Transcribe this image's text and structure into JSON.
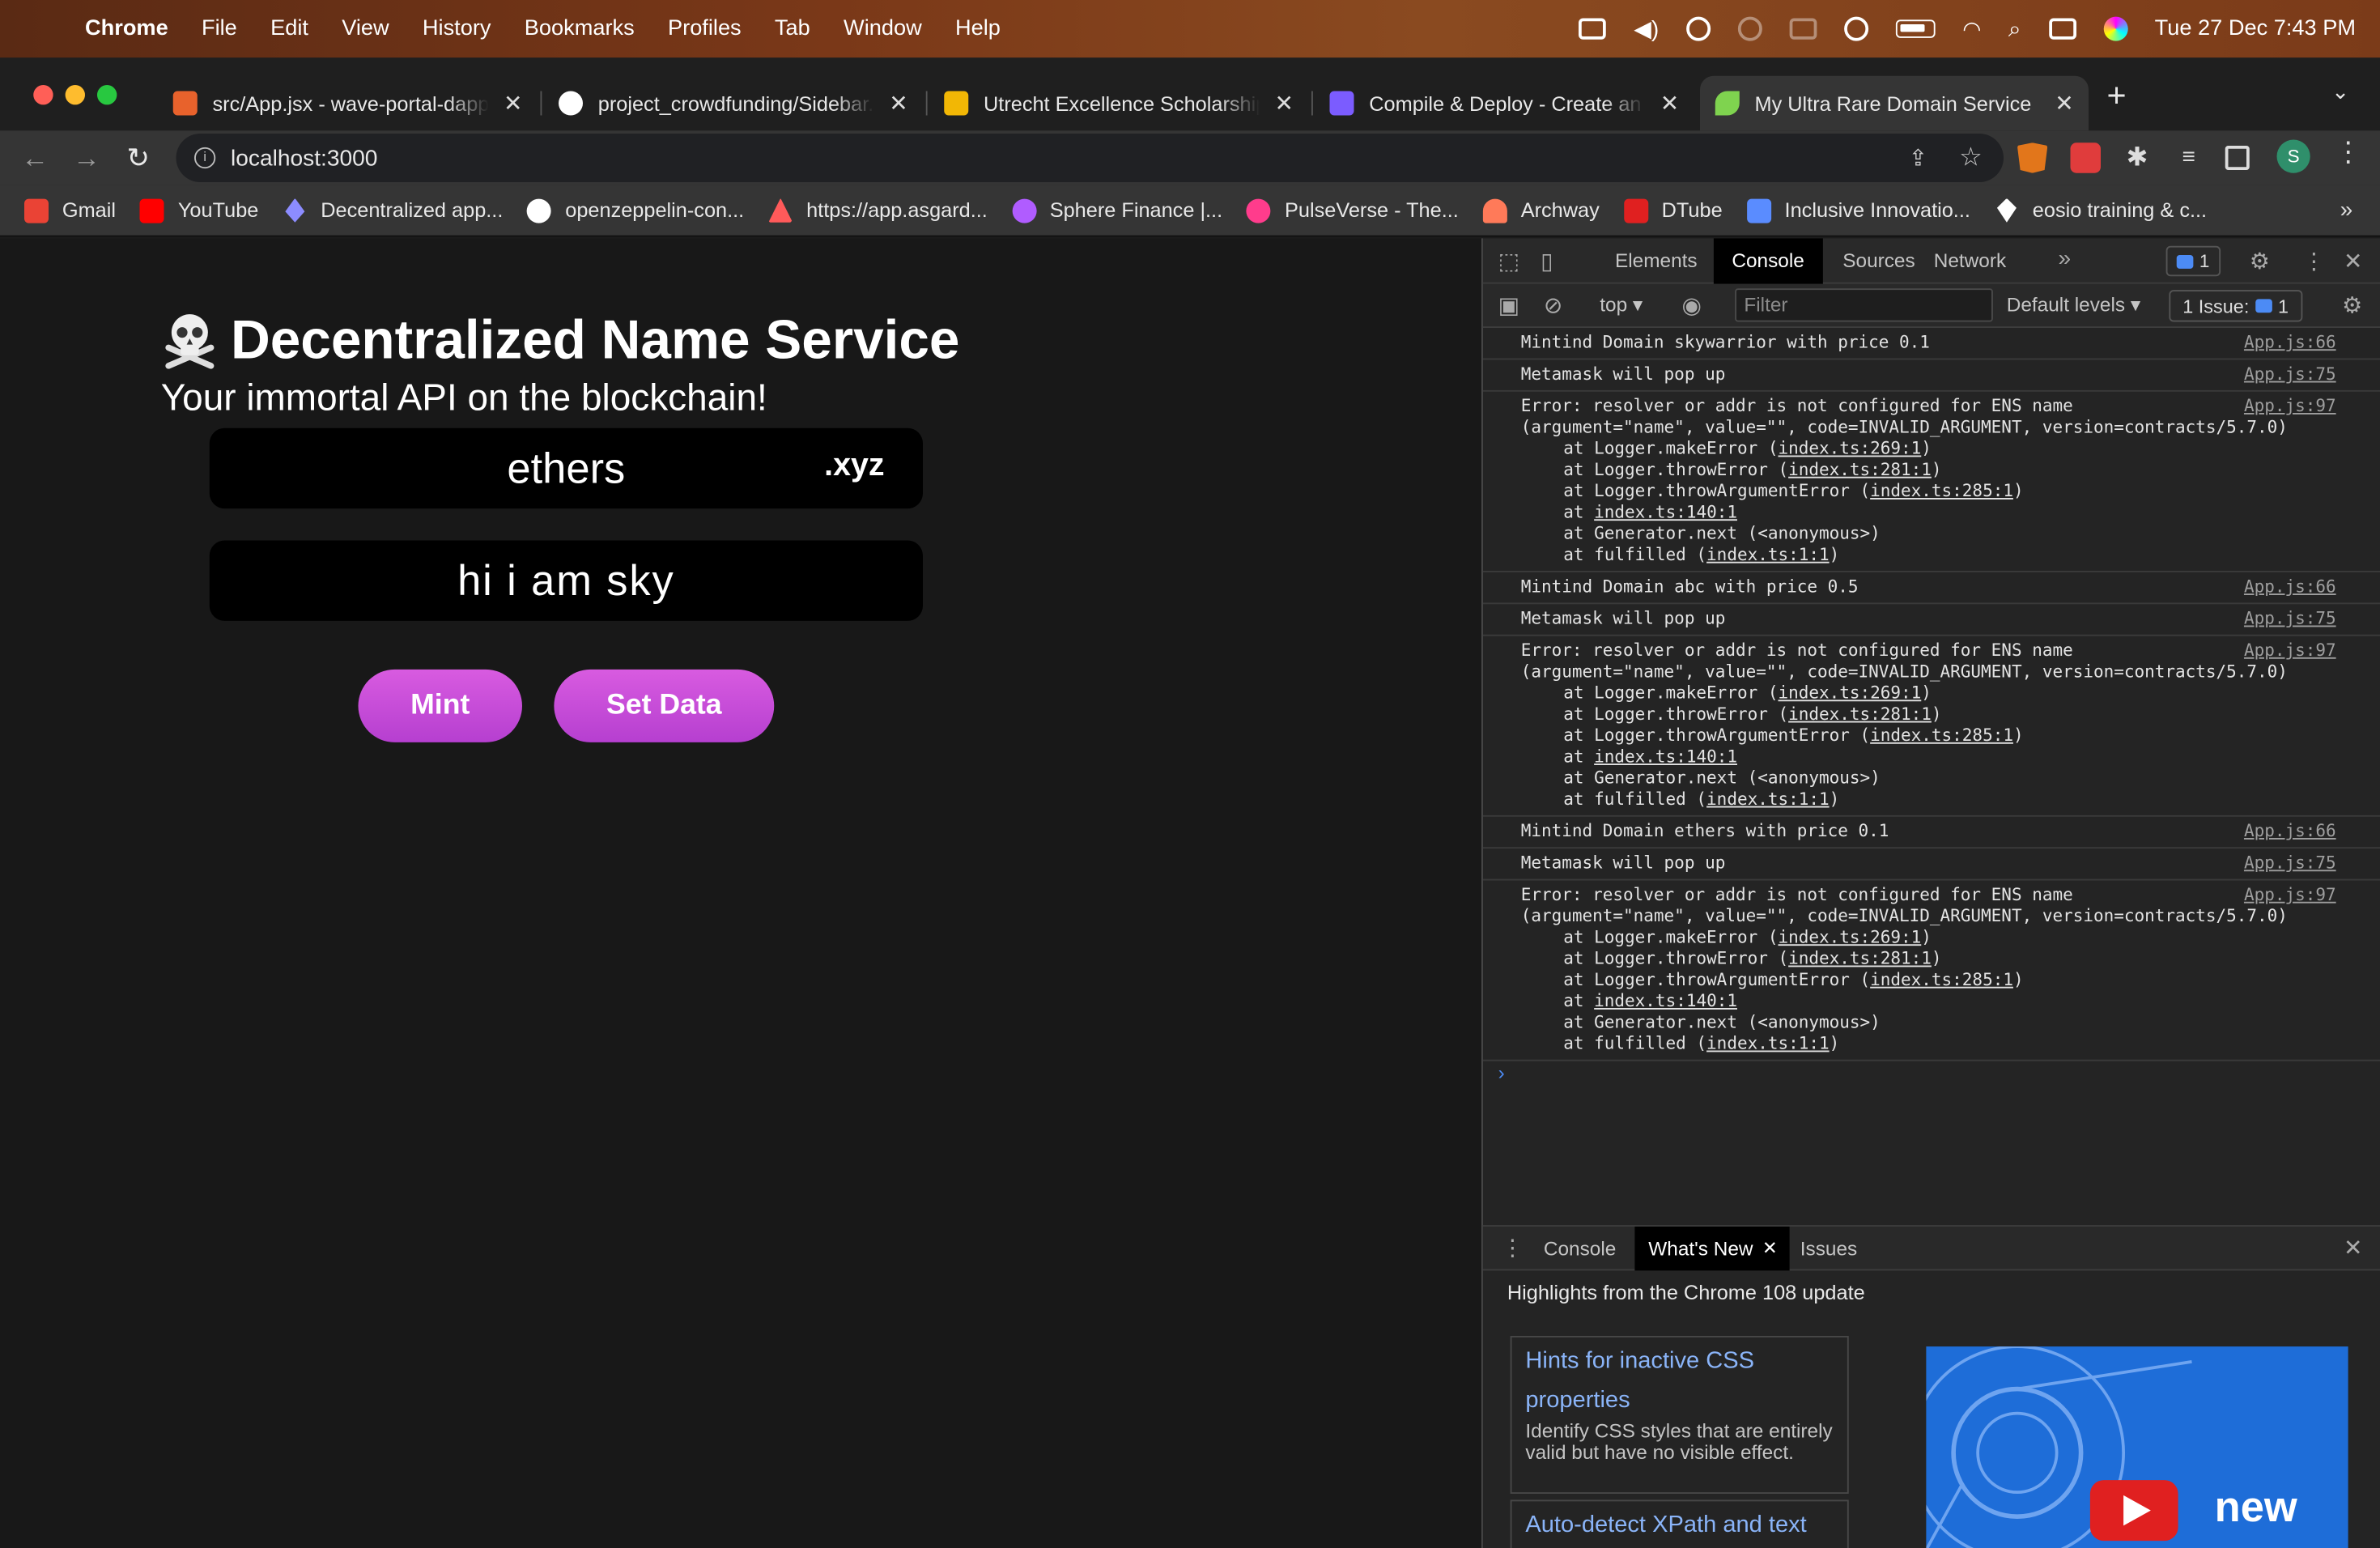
{
  "menubar": {
    "app": "Chrome",
    "items": [
      "File",
      "Edit",
      "View",
      "History",
      "Bookmarks",
      "Profiles",
      "Tab",
      "Window",
      "Help"
    ],
    "clock": "Tue 27 Dec  7:43 PM"
  },
  "tabs": [
    {
      "title": "src/App.jsx - wave-portal-dapp",
      "favicon_color": "#e8622c"
    },
    {
      "title": "project_crowdfunding/Sidebar.",
      "favicon_color": "#ffffff"
    },
    {
      "title": "Utrecht Excellence Scholarship",
      "favicon_color": "#f2b705"
    },
    {
      "title": "Compile & Deploy - Create an N",
      "favicon_color": "#7b5cff"
    },
    {
      "title": "My Ultra Rare Domain Service",
      "favicon_color": "#7fd34f"
    }
  ],
  "address": {
    "url": "localhost:3000"
  },
  "bookmarks": [
    {
      "label": "Gmail",
      "color": "#ea4335"
    },
    {
      "label": "YouTube",
      "color": "#ff0000"
    },
    {
      "label": "Decentralized app...",
      "color": "#8c8cff"
    },
    {
      "label": "openzeppelin-con...",
      "color": "#ffffff"
    },
    {
      "label": "https://app.asgard...",
      "color": "#ff5a5a"
    },
    {
      "label": "Sphere Finance |...",
      "color": "#b05cff"
    },
    {
      "label": "PulseVerse - The...",
      "color": "#ff3c8c"
    },
    {
      "label": "Archway",
      "color": "#ff7a59"
    },
    {
      "label": "DTube",
      "color": "#e02020"
    },
    {
      "label": "Inclusive Innovatio...",
      "color": "#5a8cff"
    },
    {
      "label": "eosio training & c...",
      "color": "#ffffff"
    }
  ],
  "page": {
    "title": "Decentralized Name Service",
    "subtitle": "Your immortal API on the blockchain!",
    "domain_value": "ethers",
    "tld": ".xyz",
    "record_value": "hi i am sky",
    "mint_label": "Mint",
    "setdata_label": "Set Data"
  },
  "devtools": {
    "tabs": [
      "Elements",
      "Console",
      "Sources",
      "Network"
    ],
    "active_tab": "Console",
    "badge_count": "1",
    "context": "top",
    "filter_placeholder": "Filter",
    "levels": "Default levels",
    "issues_label": "1 Issue:",
    "issues_count": "1",
    "drawer_tabs": [
      "Console",
      "What's New",
      "Issues"
    ],
    "highlights": "Highlights from the Chrome 108 update",
    "cards": [
      {
        "title": "Hints for inactive CSS properties",
        "desc": "Identify CSS styles that are entirely valid but have no visible effect."
      },
      {
        "title": "Auto-detect XPath and text",
        "desc": ""
      }
    ],
    "promo_text": "new"
  },
  "console": [
    {
      "type": "log",
      "text": "Mintind Domain skywarrior with price 0.1",
      "src": "App.js:66"
    },
    {
      "type": "log",
      "text": "Metamask will pop up",
      "src": "App.js:75"
    },
    {
      "type": "error",
      "src": "App.js:97",
      "lines": [
        "Error: resolver or addr is not configured for ENS name",
        "(argument=\"name\", value=\"\", code=INVALID_ARGUMENT, version=contracts/5.7.0)"
      ],
      "stack": [
        [
          "at Logger.makeError (",
          "index.ts:269:1",
          ")"
        ],
        [
          "at Logger.throwError (",
          "index.ts:281:1",
          ")"
        ],
        [
          "at Logger.throwArgumentError (",
          "index.ts:285:1",
          ")"
        ],
        [
          "at ",
          "index.ts:140:1",
          ""
        ],
        [
          "at Generator.next (<anonymous>)",
          "",
          ""
        ],
        [
          "at fulfilled (",
          "index.ts:1:1",
          ")"
        ]
      ]
    },
    {
      "type": "log",
      "text": "Mintind Domain abc with price 0.5",
      "src": "App.js:66"
    },
    {
      "type": "log",
      "text": "Metamask will pop up",
      "src": "App.js:75"
    },
    {
      "type": "error",
      "src": "App.js:97",
      "lines": [
        "Error: resolver or addr is not configured for ENS name",
        "(argument=\"name\", value=\"\", code=INVALID_ARGUMENT, version=contracts/5.7.0)"
      ],
      "stack": [
        [
          "at Logger.makeError (",
          "index.ts:269:1",
          ")"
        ],
        [
          "at Logger.throwError (",
          "index.ts:281:1",
          ")"
        ],
        [
          "at Logger.throwArgumentError (",
          "index.ts:285:1",
          ")"
        ],
        [
          "at ",
          "index.ts:140:1",
          ""
        ],
        [
          "at Generator.next (<anonymous>)",
          "",
          ""
        ],
        [
          "at fulfilled (",
          "index.ts:1:1",
          ")"
        ]
      ]
    },
    {
      "type": "log",
      "text": "Mintind Domain ethers with price 0.1",
      "src": "App.js:66"
    },
    {
      "type": "log",
      "text": "Metamask will pop up",
      "src": "App.js:75"
    },
    {
      "type": "error",
      "src": "App.js:97",
      "lines": [
        "Error: resolver or addr is not configured for ENS name",
        "(argument=\"name\", value=\"\", code=INVALID_ARGUMENT, version=contracts/5.7.0)"
      ],
      "stack": [
        [
          "at Logger.makeError (",
          "index.ts:269:1",
          ")"
        ],
        [
          "at Logger.throwError (",
          "index.ts:281:1",
          ")"
        ],
        [
          "at Logger.throwArgumentError (",
          "index.ts:285:1",
          ")"
        ],
        [
          "at ",
          "index.ts:140:1",
          ""
        ],
        [
          "at Generator.next (<anonymous>)",
          "",
          ""
        ],
        [
          "at fulfilled (",
          "index.ts:1:1",
          ")"
        ]
      ]
    }
  ]
}
